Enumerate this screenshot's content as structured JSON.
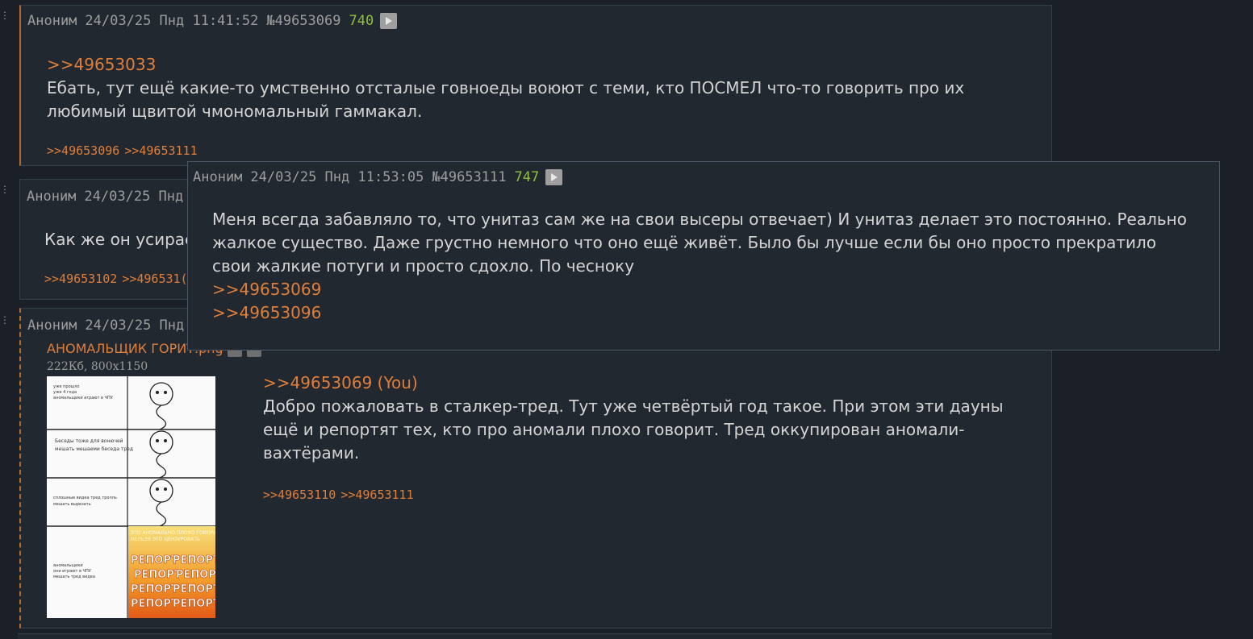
{
  "posts": [
    {
      "author": "Аноним",
      "date": "24/03/25 Пнд 11:41:52",
      "number": "№49653069",
      "count": "740",
      "reply_to": ">>49653033",
      "text": "Ебать, тут ещё какие-то умственно отсталые говноеды воюют с теми, кто ПОСМЕЛ что-то говорить про их любимый щвитой чмономальный гаммакал.",
      "replies": [
        ">>49653096",
        ">>49653111"
      ]
    },
    {
      "author": "Аноним",
      "date": "24/03/25 Пнд",
      "text": "Как же он усирае",
      "replies": [
        ">>49653102",
        ">>496531("
      ]
    },
    {
      "author": "Аноним",
      "date": "24/03/25 Пнд",
      "file_name": "АНОМАЛЬЩИК ГОРИТ.png",
      "file_meta": "222Кб, 800x1150",
      "reply_to": ">>49653069 (You)",
      "text": "Добро пожаловать в сталкер-тред. Тут уже четвёртый год такое. При этом эти дауны ещё и репортят тех, кто про аномали плохо говорит. Тред оккупирован аномали-вахтёрами.",
      "replies": [
        ">>49653110",
        ">>49653111"
      ]
    }
  ],
  "popup": {
    "author": "Аноним",
    "date": "24/03/25 Пнд 11:53:05",
    "number": "№49653111",
    "count": "747",
    "text": "Меня всегда забавляло то, что унитаз сам же на свои высеры отвечает) И унитаз делает это постоянно. Реально жалкое существо. Даже грустно немного что оно ещё живёт. Было бы лучше если бы оно просто прекратило свои жалкие потуги и просто сдохло. По чесноку",
    "links": [
      ">>49653069",
      ">>49653096"
    ]
  },
  "thumbnail": {
    "panel1_caption": "уже прошло\nуже 4 года\nаномальщики играют в ЧПУ",
    "panel2_caption": "Беседы тоже для вонючей\nмешать мешаеми беседа тред",
    "panel3_caption": "сплошные видеа тред тролль\nмешать вырезать",
    "panel4_caption": "ЭТО АНОМАЛЬНО ПЛОХО ГОВОРИТЬ\nНЕЛЬЗЯ ЭТО ЦЕНЗУРОВАТЬ",
    "report_text": "РЕПОРТ"
  },
  "colors": {
    "accent": "#e07f3a",
    "count": "#8fbf3c",
    "background": "#1b2028",
    "post": "#212830"
  }
}
